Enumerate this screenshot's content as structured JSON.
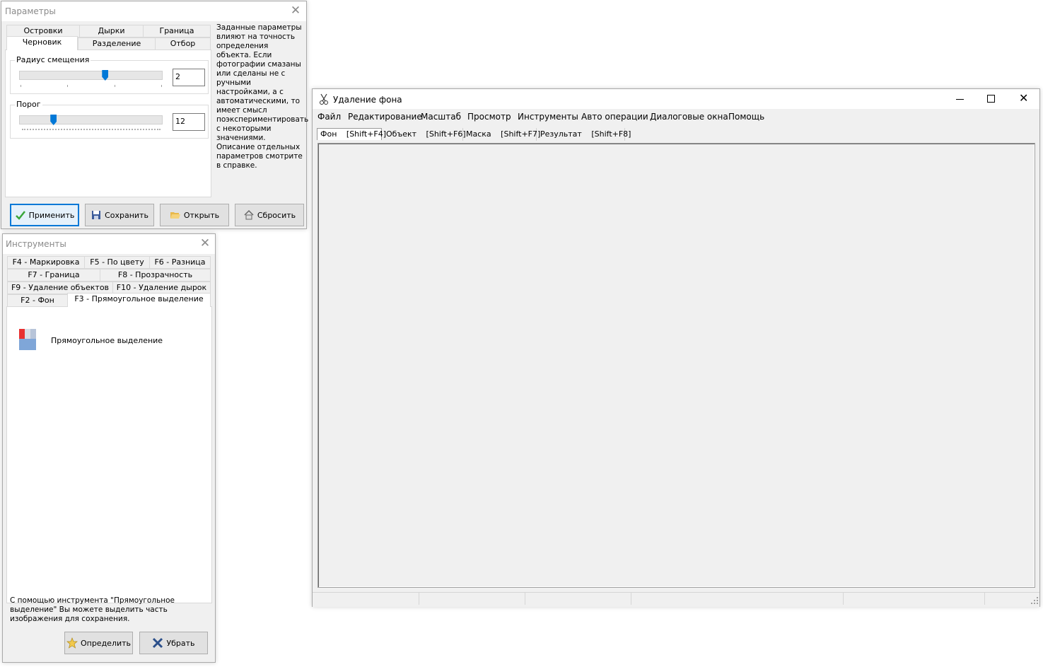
{
  "params_window": {
    "title": "Параметры",
    "tabs_row1": [
      "Островки",
      "Дырки",
      "Граница"
    ],
    "tabs_row2": [
      "Черновик",
      "Разделение",
      "Отбор"
    ],
    "radius_label": "Радиус смещения",
    "radius_value": "2",
    "radius_level": 0.6,
    "threshold_label": "Порог",
    "threshold_value": "12",
    "threshold_level": 0.24,
    "description": "Заданные параметры влияют на точность определения объекта. Если фотографии смазаны или сделаны не с ручными настройками, а с автоматическими, то имеет смысл поэкспериментировать с некоторыми значениями. Описание отдельных параметров смотрите в справке.",
    "buttons": {
      "apply": "Применить",
      "save": "Сохранить",
      "open": "Открыть",
      "reset": "Сбросить"
    }
  },
  "tools_window": {
    "title": "Инструменты",
    "tabs": {
      "row1": [
        "F4 - Маркировка",
        "F5 - По цвету",
        "F6 - Разница"
      ],
      "row2": [
        "F7 - Граница",
        "F8 - Прозрачность"
      ],
      "row3": [
        "F9 - Удаление объектов",
        "F10 - Удаление дырок"
      ],
      "row4": [
        "F2 - Фон",
        "F3 - Прямоугольное выделение"
      ]
    },
    "tool_name": "Прямоугольное выделение",
    "help_text": "С помощью инструмента \"Прямоугольное выделение\" Вы можете выделить часть изображения для сохранения.",
    "buttons": {
      "define": "Определить",
      "remove": "Убрать"
    }
  },
  "main_window": {
    "title": "Удаление фона",
    "menu": [
      "Файл",
      "Редактирование",
      "Масштаб",
      "Просмотр",
      "Инструменты",
      "Авто операции",
      "Диалоговые окна",
      "Помощь"
    ],
    "doc_tabs": [
      {
        "label": "Фон",
        "shortcut": "[Shift+F4]"
      },
      {
        "label": "Объект",
        "shortcut": "[Shift+F6]"
      },
      {
        "label": "Маска",
        "shortcut": "[Shift+F7]"
      },
      {
        "label": "Результат",
        "shortcut": "[Shift+F8]"
      }
    ],
    "active_doc_tab": "Фон"
  }
}
